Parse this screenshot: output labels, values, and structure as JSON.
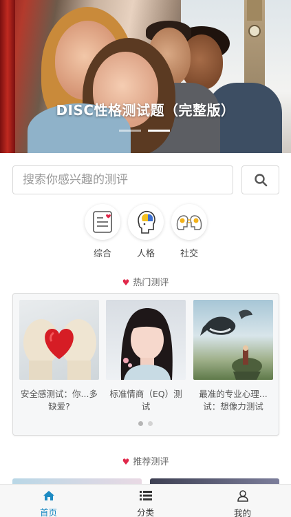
{
  "banner": {
    "title": "DISC性格测试题（完整版）",
    "slides": 2,
    "active_slide": 2
  },
  "search": {
    "placeholder": "搜索你感兴趣的测评",
    "button_icon": "search-icon"
  },
  "categories": [
    {
      "label": "综合",
      "icon": "document-heart-icon"
    },
    {
      "label": "人格",
      "icon": "head-brain-icon"
    },
    {
      "label": "社交",
      "icon": "two-heads-icon"
    }
  ],
  "hot": {
    "heading": "热门测评",
    "items": [
      {
        "title": "安全感测试：你...多缺爱?",
        "image": "gloved-hands-heart"
      },
      {
        "title": "标准情商（EQ）测试",
        "image": "girl-portrait"
      },
      {
        "title": "最准的专业心理...试：想像力测试",
        "image": "flying-whale-fantasy"
      }
    ],
    "pages": 2,
    "active_page": 1
  },
  "recommend": {
    "heading": "推荐测评"
  },
  "bottom_nav": [
    {
      "label": "首页",
      "icon": "home-icon",
      "active": true
    },
    {
      "label": "分类",
      "icon": "list-icon",
      "active": false
    },
    {
      "label": "我的",
      "icon": "user-icon",
      "active": false
    }
  ],
  "colors": {
    "accent": "#1e8bc3",
    "heart": "#e0284a",
    "border": "#d8d8d8"
  }
}
